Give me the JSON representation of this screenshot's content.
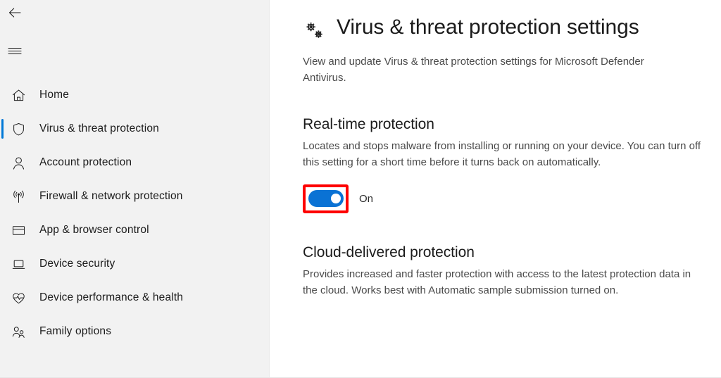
{
  "sidebar": {
    "back_icon": "back-arrow-icon",
    "menu_icon": "hamburger-menu-icon",
    "items": [
      {
        "label": "Home",
        "icon": "home-icon",
        "selected": false
      },
      {
        "label": "Virus & threat protection",
        "icon": "shield-icon",
        "selected": true
      },
      {
        "label": "Account protection",
        "icon": "person-icon",
        "selected": false
      },
      {
        "label": "Firewall & network protection",
        "icon": "broadcast-icon",
        "selected": false
      },
      {
        "label": "App & browser control",
        "icon": "window-icon",
        "selected": false
      },
      {
        "label": "Device security",
        "icon": "laptop-icon",
        "selected": false
      },
      {
        "label": "Device performance & health",
        "icon": "heart-pulse-icon",
        "selected": false
      },
      {
        "label": "Family options",
        "icon": "people-icon",
        "selected": false
      }
    ]
  },
  "main": {
    "icon": "gears-icon",
    "title": "Virus & threat protection settings",
    "description": "View and update Virus & threat protection settings for Microsoft Defender Antivirus.",
    "sections": [
      {
        "title": "Real-time protection",
        "description": "Locates and stops malware from installing or running on your device. You can turn off this setting for a short time before it turns back on automatically.",
        "toggle": {
          "state": "On",
          "checked": true
        }
      },
      {
        "title": "Cloud-delivered protection",
        "description": "Provides increased and faster protection with access to the latest protection data in the cloud. Works best with Automatic sample submission turned on."
      }
    ]
  },
  "colors": {
    "accent": "#0078d7",
    "toggle_on": "#0a72d4",
    "highlight": "#fe0000",
    "sidebar_bg": "#f2f2f2",
    "content_bg": "#ffffff",
    "text_primary": "#1b1b1b",
    "text_secondary": "#4a4a4a"
  }
}
